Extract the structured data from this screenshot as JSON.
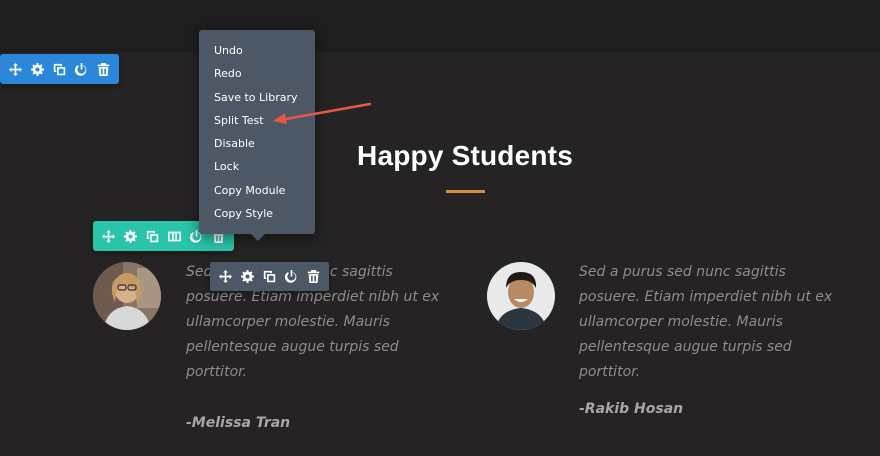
{
  "context_menu": {
    "items": [
      "Undo",
      "Redo",
      "Save to Library",
      "Split Test",
      "Disable",
      "Lock",
      "Copy Module",
      "Copy Style"
    ],
    "highlighted_item": "Split Test"
  },
  "toolbars": {
    "section": {
      "color": "#2b87da",
      "icons": [
        "move-icon",
        "gear-icon",
        "duplicate-icon",
        "power-icon",
        "trash-icon"
      ]
    },
    "row": {
      "color": "#29c4a9",
      "icons": [
        "move-icon",
        "gear-icon",
        "duplicate-icon",
        "columns-icon",
        "power-icon",
        "trash-icon"
      ]
    },
    "module": {
      "color": "#4c5866",
      "icons": [
        "move-icon",
        "gear-icon",
        "duplicate-icon",
        "power-icon",
        "trash-icon"
      ]
    }
  },
  "heading": "Happy Students",
  "accent_color": "#d48f3c",
  "arrow_color": "#e8564a",
  "testimonials": [
    {
      "quote": "Sed a purus sed nunc sagittis posuere. Etiam imperdiet nibh ut ex ullamcorper molestie. Mauris pellentesque augue turpis sed porttitor.",
      "author": "-Melissa Tran"
    },
    {
      "quote": "Sed a purus sed nunc sagittis posuere. Etiam imperdiet nibh ut ex ullamcorper molestie. Mauris pellentesque augue turpis sed porttitor.",
      "author": "-Rakib Hosan"
    }
  ]
}
